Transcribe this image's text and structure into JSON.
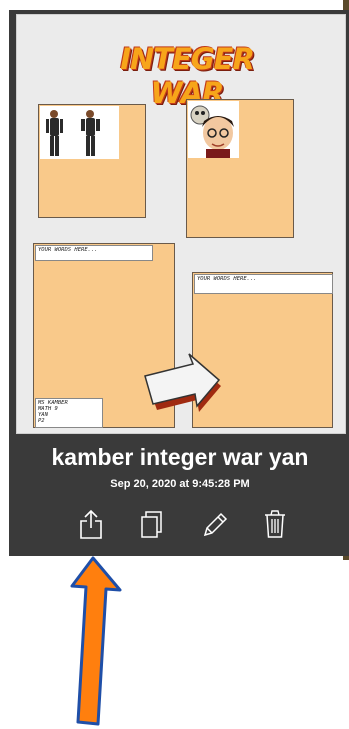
{
  "comic": {
    "title": "INTEGER WAR",
    "caption_1": "YOUR WORDS HERE...",
    "caption_2": "YOUR WORDS HERE...",
    "credits": [
      "MS KAMBER",
      "MATH 9",
      "YAN",
      "P2"
    ]
  },
  "card": {
    "title": "kamber integer war yan",
    "date": "Sep 20, 2020 at 9:45:28 PM"
  },
  "toolbar": {
    "items": [
      "share-icon",
      "duplicate-icon",
      "edit-icon",
      "trash-icon"
    ]
  },
  "colors": {
    "card_bg": "#3a3a3a",
    "panel_fill": "#f9c98a",
    "arrow": "#ff7f0e"
  }
}
